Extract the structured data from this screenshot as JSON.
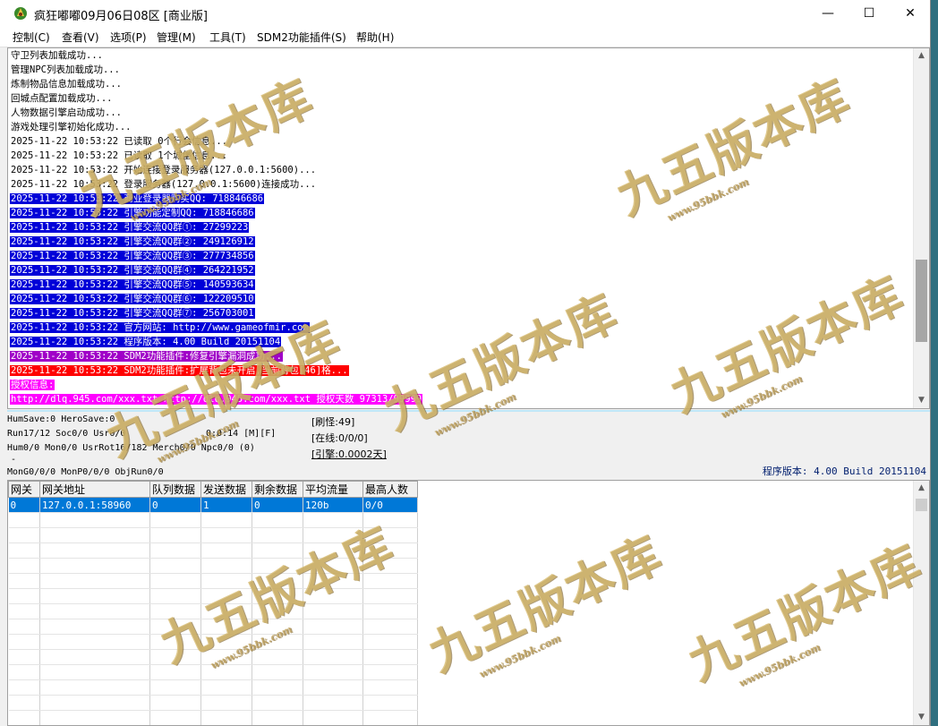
{
  "window": {
    "title": "疯狂嘟嘟09月06日08区 [商业版]",
    "controls": {
      "minimize": "—",
      "maximize": "☐",
      "close": "✕"
    }
  },
  "menu": [
    "控制(C)",
    "查看(V)",
    "选项(P)",
    "管理(M)",
    "工具(T)",
    "SDM2功能插件(S)",
    "帮助(H)"
  ],
  "log": [
    {
      "text": "守卫列表加载成功...",
      "style": "plain"
    },
    {
      "text": "管理NPC列表加载成功...",
      "style": "plain"
    },
    {
      "text": "炼制物品信息加载成功...",
      "style": "plain"
    },
    {
      "text": "回城点配置加载成功...",
      "style": "plain"
    },
    {
      "text": "人物数据引擎启动成功...",
      "style": "plain"
    },
    {
      "text": "游戏处理引擎初始化成功...",
      "style": "plain"
    },
    {
      "text": "2025-11-22 10:53:22 已读取 0个行会信息...",
      "style": "plain"
    },
    {
      "text": "2025-11-22 10:53:22 已读取 1个城堡信息...",
      "style": "plain"
    },
    {
      "text": "2025-11-22 10:53:22 开始连接登录服务器(127.0.0.1:5600)...",
      "style": "plain"
    },
    {
      "text": "2025-11-22 10:53:22 登录服务器(127.0.0.1:5600)连接成功...",
      "style": "plain"
    },
    {
      "text": "2025-11-22 10:53:22 商业登录器购买QQ: 718846686",
      "style": "blue"
    },
    {
      "text": "2025-11-22 10:53:22 引擎功能定制QQ: 718846686",
      "style": "blue"
    },
    {
      "text": "2025-11-22 10:53:22 引擎交流QQ群①: 27299223",
      "style": "blue"
    },
    {
      "text": "2025-11-22 10:53:22 引擎交流QQ群②: 249126912",
      "style": "blue"
    },
    {
      "text": "2025-11-22 10:53:22 引擎交流QQ群③: 277734856",
      "style": "blue"
    },
    {
      "text": "2025-11-22 10:53:22 引擎交流QQ群④: 264221952",
      "style": "blue"
    },
    {
      "text": "2025-11-22 10:53:22 引擎交流QQ群⑤: 140593634",
      "style": "blue"
    },
    {
      "text": "2025-11-22 10:53:22 引擎交流QQ群⑥: 122209510",
      "style": "blue"
    },
    {
      "text": "2025-11-22 10:53:22 引擎交流QQ群⑦: 256703001",
      "style": "blue"
    },
    {
      "text": "2025-11-22 10:53:22 官方网站: http://www.gameofmir.com",
      "style": "blue"
    },
    {
      "text": "2025-11-22 10:53:22 程序版本: 4.00 Build 20151104",
      "style": "blue"
    },
    {
      "text": "2025-11-22 10:53:22 SDM2功能插件:修复引擎漏洞成功...",
      "style": "purple"
    },
    {
      "text": "2025-11-22 10:53:22 SDM2功能插件:扩展背包未开启,当前背包[46]格...",
      "style": "red"
    },
    {
      "text": "授权信息:",
      "style": "magenta"
    },
    {
      "text": "http://dlq.945.com/xxx.txt http://dlq.945.com/xxx.txt 授权天数 97313/99999",
      "style": "magenta"
    }
  ],
  "status": {
    "line1": "HumSave:0 HeroSave:0",
    "line2": "Run17/12 Soc0/0 Usr0/0",
    "line2b": "0:0:14 [M][F]",
    "line3": "Hum0/0 Mon0/0 UsrRot16/182 Merch0/0 Npc0/0 (0)",
    "line4": "-",
    "line5": "MonG0/0/0 MonP0/0/0 ObjRun0/0",
    "box1": "[刷怪:49]",
    "box2": "[在线:0/0/0]",
    "box3": "[引擎:0.0002天]",
    "version": "程序版本: 4.00 Build 20151104"
  },
  "gateway_table": {
    "headers": [
      "网关",
      "网关地址",
      "队列数据",
      "发送数据",
      "剩余数据",
      "平均流量",
      "最高人数"
    ],
    "rows": [
      [
        "0",
        "127.0.0.1:58960",
        "0",
        "1",
        "0",
        "120b",
        "0/0"
      ]
    ],
    "empty_rows": 14
  },
  "watermark": {
    "text": "九五版本库",
    "url": "www.95bbk.com"
  }
}
